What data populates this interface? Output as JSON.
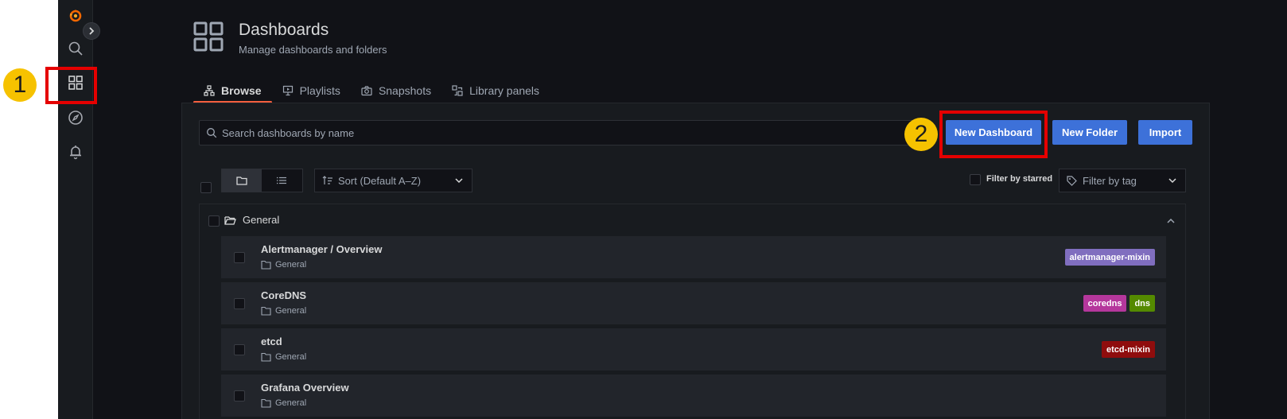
{
  "annotations": {
    "marker1": "1",
    "marker2": "2"
  },
  "sidebar": {
    "icons": [
      "grafana-logo-icon",
      "search-icon",
      "dashboards-icon",
      "explore-icon",
      "alerting-icon"
    ]
  },
  "header": {
    "title": "Dashboards",
    "subtitle": "Manage dashboards and folders"
  },
  "tabs": [
    {
      "label": "Browse",
      "active": true
    },
    {
      "label": "Playlists",
      "active": false
    },
    {
      "label": "Snapshots",
      "active": false
    },
    {
      "label": "Library panels",
      "active": false
    }
  ],
  "search": {
    "placeholder": "Search dashboards by name"
  },
  "buttons": {
    "new_dashboard": "New Dashboard",
    "new_folder": "New Folder",
    "import": "Import"
  },
  "toolbar": {
    "sort_label": "Sort (Default A–Z)",
    "filter_starred": "Filter by starred",
    "filter_tag_placeholder": "Filter by tag"
  },
  "folder": {
    "name": "General"
  },
  "dashboards": [
    {
      "title": "Alertmanager / Overview",
      "folder": "General",
      "tags": [
        {
          "label": "alertmanager-mixin",
          "color": "#806ebf"
        }
      ]
    },
    {
      "title": "CoreDNS",
      "folder": "General",
      "tags": [
        {
          "label": "coredns",
          "color": "#b5379c"
        },
        {
          "label": "dns",
          "color": "#548a00"
        }
      ]
    },
    {
      "title": "etcd",
      "folder": "General",
      "tags": [
        {
          "label": "etcd-mixin",
          "color": "#8f0d0d"
        }
      ]
    },
    {
      "title": "Grafana Overview",
      "folder": "General",
      "tags": []
    }
  ],
  "colors": {
    "accent": "#3d71d9",
    "annotation_box": "#e50000",
    "annotation_marker": "#f6c200",
    "active_tab_underline": "#f55f3e"
  }
}
